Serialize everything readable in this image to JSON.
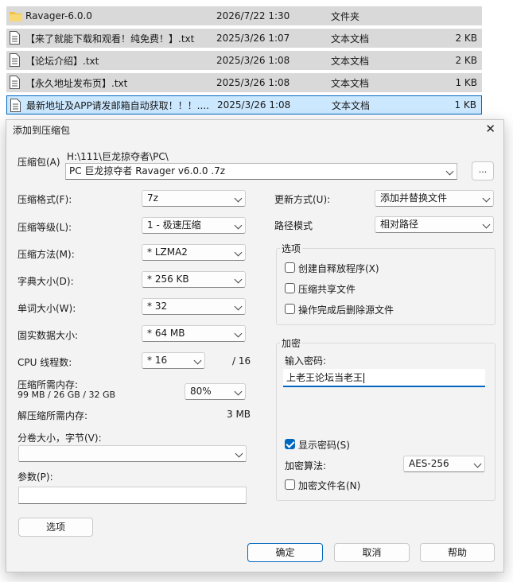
{
  "files": [
    {
      "name": "Ravager-6.0.0",
      "date": "2026/7/22 1:30",
      "type": "文件夹",
      "size": "",
      "kind": "folder"
    },
    {
      "name": "【来了就能下载和观看！纯免费！】.txt",
      "date": "2025/3/26 1:07",
      "type": "文本文档",
      "size": "2 KB",
      "kind": "text"
    },
    {
      "name": "【论坛介绍】.txt",
      "date": "2025/3/26 1:08",
      "type": "文本文档",
      "size": "2 KB",
      "kind": "text"
    },
    {
      "name": "【永久地址发布页】.txt",
      "date": "2025/3/26 1:08",
      "type": "文本文档",
      "size": "1 KB",
      "kind": "text"
    },
    {
      "name": "最新地址及APP请发邮箱自动获取！！！....",
      "date": "2025/3/26 1:08",
      "type": "文本文档",
      "size": "1 KB",
      "kind": "text"
    }
  ],
  "dialog": {
    "title": "添加到压缩包",
    "close_icon": "close-icon",
    "archive_label": "压缩包(A)",
    "archive_path": "H:\\111\\巨龙掠夺者\\PC\\",
    "archive_name": "PC 巨龙掠夺者 Ravager  v6.0.0 .7z",
    "browse_label": "...",
    "format_label": "压缩格式(F):",
    "format_value": "7z",
    "level_label": "压缩等级(L):",
    "level_value": "1 - 极速压缩",
    "method_label": "压缩方法(M):",
    "method_value": "*  LZMA2",
    "dict_label": "字典大小(D):",
    "dict_value": "*  256 KB",
    "word_label": "单词大小(W):",
    "word_value": "*  32",
    "solid_label": "固实数据大小:",
    "solid_value": "*  64 MB",
    "threads_label": "CPU 线程数:",
    "threads_value": "*  16",
    "threads_total": "/ 16",
    "mem_compress_label": "压缩所需内存:",
    "mem_compress_value": "99 MB / 26 GB / 32 GB",
    "mem_percent": "80%",
    "mem_decompress_label": "解压缩所需内存:",
    "mem_decompress_value": "3 MB",
    "split_label": "分卷大小，字节(V):",
    "split_value": "",
    "params_label": "参数(P):",
    "params_value": "",
    "update_label": "更新方式(U):",
    "update_value": "添加并替换文件",
    "pathmode_label": "路径模式",
    "pathmode_value": "相对路径",
    "options_title": "选项",
    "opt_sfx": "创建自释放程序(X)",
    "opt_shared": "压缩共享文件",
    "opt_delete": "操作完成后删除源文件",
    "encrypt_title": "加密",
    "password_label": "输入密码:",
    "password_value": "上老王论坛当老王",
    "show_password": "显示密码(S)",
    "enc_method_label": "加密算法:",
    "enc_method_value": "AES-256",
    "encrypt_names": "加密文件名(N)",
    "options_button": "选项",
    "ok_button": "确定",
    "cancel_button": "取消",
    "help_button": "帮助"
  }
}
